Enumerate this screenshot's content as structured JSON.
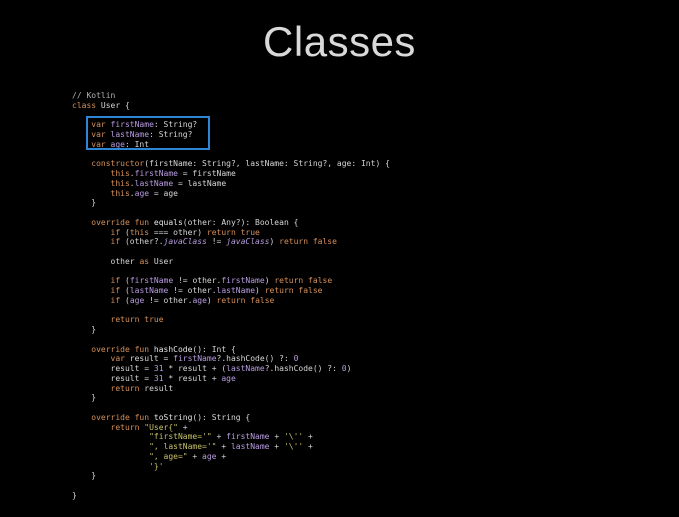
{
  "slide": {
    "title": "Classes"
  },
  "code": {
    "lines": [
      [
        [
          "comment",
          "// Kotlin"
        ]
      ],
      [
        [
          "kw",
          "class"
        ],
        [
          "plain",
          " User {"
        ]
      ],
      [],
      [
        [
          "plain",
          "    "
        ],
        [
          "kw",
          "var "
        ],
        [
          "prop",
          "firstName"
        ],
        [
          "plain",
          ": String?"
        ]
      ],
      [
        [
          "plain",
          "    "
        ],
        [
          "kw",
          "var "
        ],
        [
          "prop",
          "lastName"
        ],
        [
          "plain",
          ": String?"
        ]
      ],
      [
        [
          "plain",
          "    "
        ],
        [
          "kw",
          "var "
        ],
        [
          "prop",
          "age"
        ],
        [
          "plain",
          ": Int"
        ]
      ],
      [],
      [
        [
          "plain",
          "    "
        ],
        [
          "kw",
          "constructor"
        ],
        [
          "plain",
          "(firstName: String?, lastName: String?, age: Int) {"
        ]
      ],
      [
        [
          "plain",
          "        "
        ],
        [
          "kw",
          "this"
        ],
        [
          "plain",
          "."
        ],
        [
          "prop",
          "firstName"
        ],
        [
          "plain",
          " = firstName"
        ]
      ],
      [
        [
          "plain",
          "        "
        ],
        [
          "kw",
          "this"
        ],
        [
          "plain",
          "."
        ],
        [
          "prop",
          "lastName"
        ],
        [
          "plain",
          " = lastName"
        ]
      ],
      [
        [
          "plain",
          "        "
        ],
        [
          "kw",
          "this"
        ],
        [
          "plain",
          "."
        ],
        [
          "prop",
          "age"
        ],
        [
          "plain",
          " = age"
        ]
      ],
      [
        [
          "plain",
          "    }"
        ]
      ],
      [],
      [
        [
          "plain",
          "    "
        ],
        [
          "kw",
          "override fun "
        ],
        [
          "fn",
          "equals"
        ],
        [
          "plain",
          "(other: Any?): Boolean {"
        ]
      ],
      [
        [
          "plain",
          "        "
        ],
        [
          "kw",
          "if "
        ],
        [
          "plain",
          "("
        ],
        [
          "kw",
          "this"
        ],
        [
          "plain",
          " === other) "
        ],
        [
          "kw",
          "return true"
        ]
      ],
      [
        [
          "plain",
          "        "
        ],
        [
          "kw",
          "if "
        ],
        [
          "plain",
          "(other?."
        ],
        [
          "it",
          "javaClass"
        ],
        [
          "plain",
          " != "
        ],
        [
          "it",
          "javaClass"
        ],
        [
          "plain",
          ") "
        ],
        [
          "kw",
          "return false"
        ]
      ],
      [],
      [
        [
          "plain",
          "        other "
        ],
        [
          "kw",
          "as "
        ],
        [
          "plain",
          "User"
        ]
      ],
      [],
      [
        [
          "plain",
          "        "
        ],
        [
          "kw",
          "if "
        ],
        [
          "plain",
          "("
        ],
        [
          "prop",
          "firstName"
        ],
        [
          "plain",
          " != other."
        ],
        [
          "prop",
          "firstName"
        ],
        [
          "plain",
          ") "
        ],
        [
          "kw",
          "return false"
        ]
      ],
      [
        [
          "plain",
          "        "
        ],
        [
          "kw",
          "if "
        ],
        [
          "plain",
          "("
        ],
        [
          "prop",
          "lastName"
        ],
        [
          "plain",
          " != other."
        ],
        [
          "prop",
          "lastName"
        ],
        [
          "plain",
          ") "
        ],
        [
          "kw",
          "return false"
        ]
      ],
      [
        [
          "plain",
          "        "
        ],
        [
          "kw",
          "if "
        ],
        [
          "plain",
          "("
        ],
        [
          "prop",
          "age"
        ],
        [
          "plain",
          " != other."
        ],
        [
          "prop",
          "age"
        ],
        [
          "plain",
          ") "
        ],
        [
          "kw",
          "return false"
        ]
      ],
      [],
      [
        [
          "plain",
          "        "
        ],
        [
          "kw",
          "return true"
        ]
      ],
      [
        [
          "plain",
          "    }"
        ]
      ],
      [],
      [
        [
          "plain",
          "    "
        ],
        [
          "kw",
          "override fun "
        ],
        [
          "fn",
          "hashCode"
        ],
        [
          "plain",
          "(): Int {"
        ]
      ],
      [
        [
          "plain",
          "        "
        ],
        [
          "kw",
          "var "
        ],
        [
          "plain",
          "result = "
        ],
        [
          "prop",
          "firstName"
        ],
        [
          "plain",
          "?.hashCode() ?: "
        ],
        [
          "num",
          "0"
        ]
      ],
      [
        [
          "plain",
          "        result = "
        ],
        [
          "num",
          "31"
        ],
        [
          "plain",
          " * result + ("
        ],
        [
          "prop",
          "lastName"
        ],
        [
          "plain",
          "?.hashCode() ?: "
        ],
        [
          "num",
          "0"
        ],
        [
          "plain",
          ")"
        ]
      ],
      [
        [
          "plain",
          "        result = "
        ],
        [
          "num",
          "31"
        ],
        [
          "plain",
          " * result + "
        ],
        [
          "prop",
          "age"
        ]
      ],
      [
        [
          "plain",
          "        "
        ],
        [
          "kw",
          "return "
        ],
        [
          "plain",
          "result"
        ]
      ],
      [
        [
          "plain",
          "    }"
        ]
      ],
      [],
      [
        [
          "plain",
          "    "
        ],
        [
          "kw",
          "override fun "
        ],
        [
          "fn",
          "toString"
        ],
        [
          "plain",
          "(): String {"
        ]
      ],
      [
        [
          "plain",
          "        "
        ],
        [
          "kw",
          "return "
        ],
        [
          "str",
          "\"User{\""
        ],
        [
          "plain",
          " +"
        ]
      ],
      [
        [
          "plain",
          "                "
        ],
        [
          "str",
          "\"firstName='\""
        ],
        [
          "plain",
          " + "
        ],
        [
          "prop",
          "firstName"
        ],
        [
          "plain",
          " + "
        ],
        [
          "str",
          "'\\''"
        ],
        [
          "plain",
          " +"
        ]
      ],
      [
        [
          "plain",
          "                "
        ],
        [
          "str",
          "\", lastName='\""
        ],
        [
          "plain",
          " + "
        ],
        [
          "prop",
          "lastName"
        ],
        [
          "plain",
          " + "
        ],
        [
          "str",
          "'\\''"
        ],
        [
          "plain",
          " +"
        ]
      ],
      [
        [
          "plain",
          "                "
        ],
        [
          "str",
          "\", age=\""
        ],
        [
          "plain",
          " + "
        ],
        [
          "prop",
          "age"
        ],
        [
          "plain",
          " +"
        ]
      ],
      [
        [
          "plain",
          "                "
        ],
        [
          "str",
          "'}'"
        ]
      ],
      [
        [
          "plain",
          "    }"
        ]
      ],
      [],
      [
        [
          "plain",
          "}"
        ]
      ]
    ]
  },
  "colors": {
    "background": "#000000",
    "title": "#d9d9d9",
    "highlight_border": "#2f86d6",
    "keyword": "#d6905a",
    "property": "#b89be0",
    "string": "#c7c06a"
  }
}
